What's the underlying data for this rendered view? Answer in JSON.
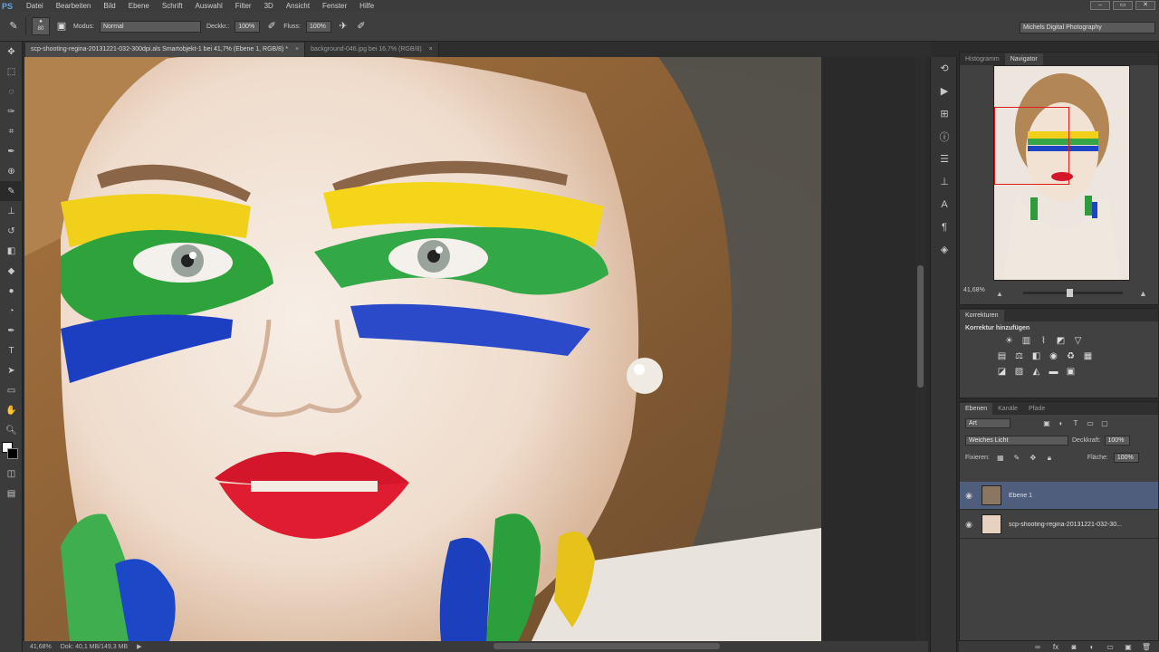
{
  "app": {
    "logo": "PS"
  },
  "menu": [
    "Datei",
    "Bearbeiten",
    "Bild",
    "Ebene",
    "Schrift",
    "Auswahl",
    "Filter",
    "3D",
    "Ansicht",
    "Fenster",
    "Hilfe"
  ],
  "options": {
    "brush_size": "80",
    "mode_label": "Modus:",
    "mode_value": "Normal",
    "opacity_label": "Deckkr.:",
    "opacity_value": "100%",
    "flow_label": "Fluss:",
    "flow_value": "100%",
    "workspace": "Michels Digital Photography"
  },
  "tabs": [
    {
      "label": "scp-shooting-regina-20131221-032-300dpi.als Smartobjekt-1 bei 41,7% (Ebene 1, RGB/8) *",
      "close": "×"
    },
    {
      "label": "background-046.jpg bei 16,7% (RGB/8)",
      "close": "×"
    }
  ],
  "status": {
    "zoom": "41,68%",
    "doc": "Dok: 40,1 MB/149,3 MB",
    "arrow": "▶"
  },
  "panels": {
    "top_tabs": [
      "Histogramm",
      "Navigator"
    ],
    "navigator_zoom": "41,68%",
    "corrections_title": "Korrekturen",
    "corrections_subtitle": "Korrektur hinzufügen",
    "layers_tabs": [
      "Ebenen",
      "Kanäle",
      "Pfade"
    ],
    "kind_filter": "Art",
    "blend_mode": "Weiches Licht",
    "opacity_label": "Deckkraft:",
    "opacity_value": "100%",
    "lock_label": "Fixieren:",
    "fill_label": "Fläche:",
    "fill_value": "100%",
    "layers": [
      {
        "name": "Ebene 1",
        "selected": true
      },
      {
        "name": "scp-shooting-regina-20131221-032-30..."
      }
    ]
  },
  "colors": {
    "accent": "#4f5e7d",
    "nav_rect": "#e21b1b",
    "logo": "#5fa7e6"
  }
}
